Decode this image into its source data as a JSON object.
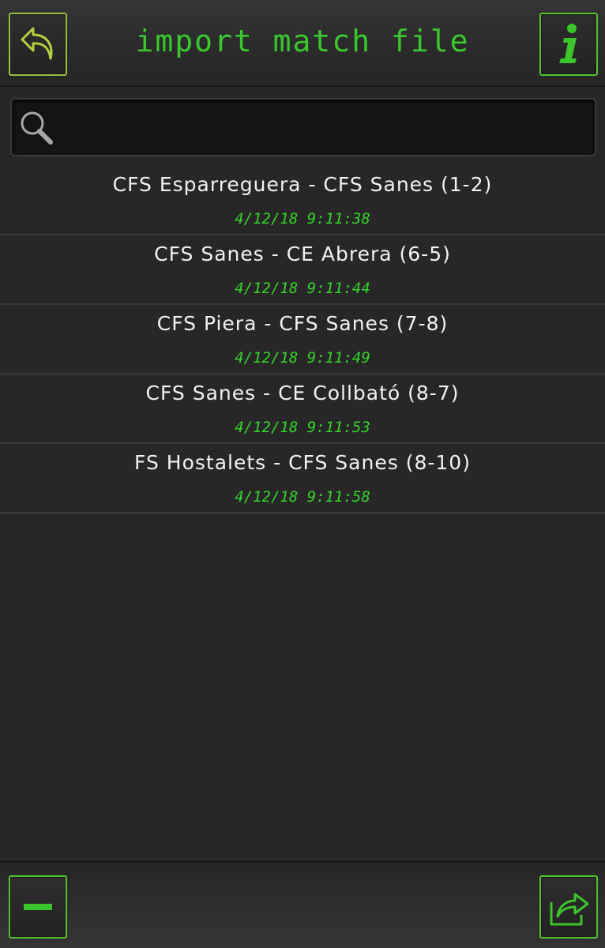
{
  "header": {
    "title": "import match file",
    "back_icon": "back-arrow-icon",
    "info_icon": "info-icon"
  },
  "search": {
    "value": "",
    "placeholder": "",
    "icon": "search-icon"
  },
  "matches": [
    {
      "name": "CFS Esparreguera - CFS Sanes (1-2)",
      "time": "4/12/18 9:11:38"
    },
    {
      "name": "CFS Sanes - CE Abrera (6-5)",
      "time": "4/12/18 9:11:44"
    },
    {
      "name": "CFS Piera - CFS Sanes (7-8)",
      "time": "4/12/18 9:11:49"
    },
    {
      "name": "CFS Sanes - CE Collbató (8-7)",
      "time": "4/12/18 9:11:53"
    },
    {
      "name": "FS Hostalets - CFS Sanes (8-10)",
      "time": "4/12/18 9:11:58"
    }
  ],
  "footer": {
    "minus_icon": "minus-icon",
    "share_icon": "share-icon"
  },
  "colors": {
    "accent_green": "#39c82d",
    "back_border": "#9ac13a",
    "background": "#272727"
  }
}
